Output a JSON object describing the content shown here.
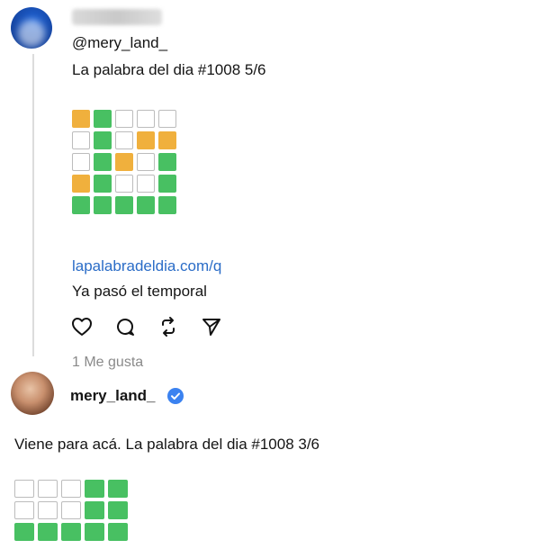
{
  "reply": {
    "handle": "@mery_land_",
    "title": "La palabra del dia #1008 5/6",
    "grid": [
      [
        "y",
        "g",
        "w",
        "w",
        "w"
      ],
      [
        "w",
        "g",
        "w",
        "y",
        "y"
      ],
      [
        "w",
        "g",
        "y",
        "w",
        "g"
      ],
      [
        "y",
        "g",
        "w",
        "w",
        "g"
      ],
      [
        "g",
        "g",
        "g",
        "g",
        "g"
      ]
    ],
    "link": "lapalabradeldia.com/q",
    "comment": "Ya pasó el temporal",
    "actions": [
      "heart-icon",
      "comment-icon",
      "repost-icon",
      "share-icon"
    ],
    "likes": "1 Me gusta"
  },
  "post": {
    "username": "mery_land_",
    "verified": true,
    "text": "Viene para acá. La palabra del dia #1008 3/6",
    "grid": [
      [
        "w",
        "w",
        "w",
        "g",
        "g"
      ],
      [
        "w",
        "w",
        "w",
        "g",
        "g"
      ],
      [
        "g",
        "g",
        "g",
        "g",
        "g"
      ]
    ]
  },
  "colors": {
    "green": "#48c062",
    "yellow": "#f0b03d",
    "link": "#2a6cc7",
    "verified": "#3b82f0"
  }
}
